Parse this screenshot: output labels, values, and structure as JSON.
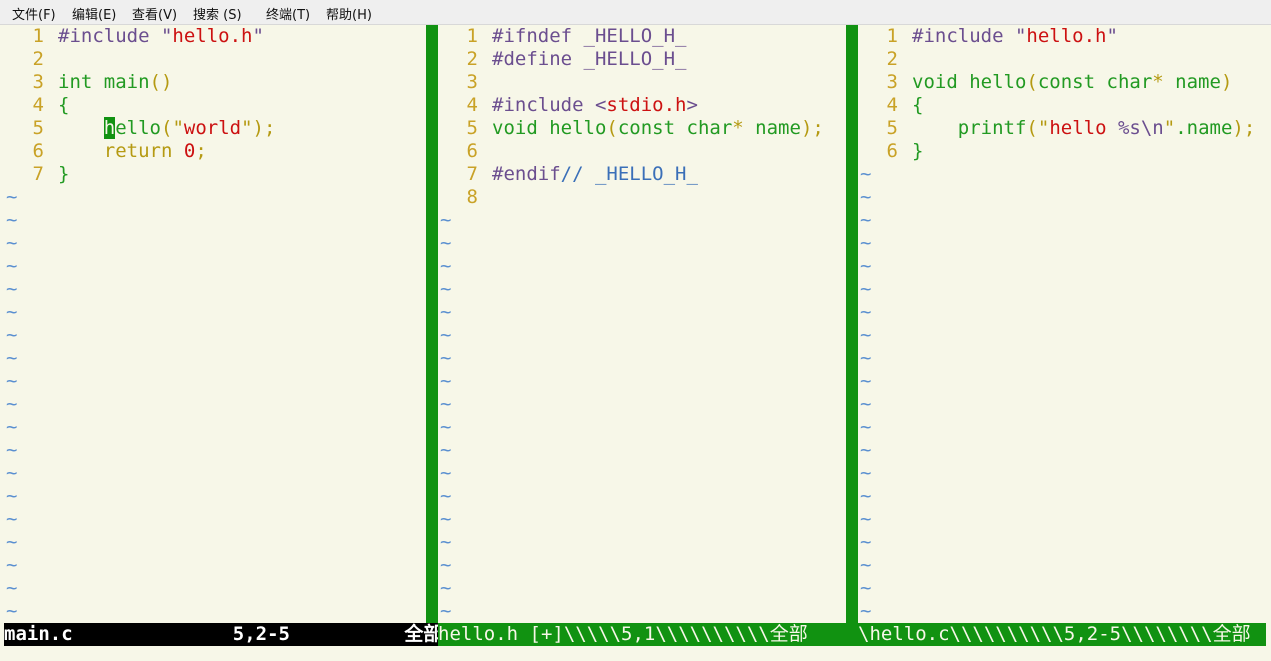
{
  "menu": [
    {
      "label": "文件(F)"
    },
    {
      "label": "编辑(E)"
    },
    {
      "label": "查看(V)"
    },
    {
      "label": "搜索 (S)"
    },
    {
      "label": "终端(T)"
    },
    {
      "label": "帮助(H)"
    }
  ],
  "panes": [
    {
      "name": "main.c",
      "tildes": 19,
      "lines": [
        {
          "n": "1",
          "tokens": [
            {
              "t": "#include ",
              "c": "pre"
            },
            {
              "t": "\"",
              "c": "pre"
            },
            {
              "t": "hello.h",
              "c": "str"
            },
            {
              "t": "\"",
              "c": "pre"
            }
          ]
        },
        {
          "n": "2",
          "tokens": []
        },
        {
          "n": "3",
          "tokens": [
            {
              "t": "int",
              "c": "type"
            },
            {
              "t": " main",
              "c": "fn"
            },
            {
              "t": "()",
              "c": "punc"
            }
          ]
        },
        {
          "n": "4",
          "tokens": [
            {
              "t": "{",
              "c": "plain"
            }
          ]
        },
        {
          "n": "5",
          "tokens": [
            {
              "t": "    ",
              "c": "plain"
            },
            {
              "t": "h",
              "c": "cursor"
            },
            {
              "t": "ello",
              "c": "fn"
            },
            {
              "t": "(",
              "c": "punc"
            },
            {
              "t": "\"",
              "c": "punc"
            },
            {
              "t": "world",
              "c": "str"
            },
            {
              "t": "\"",
              "c": "punc"
            },
            {
              "t": ");",
              "c": "punc"
            }
          ]
        },
        {
          "n": "6",
          "tokens": [
            {
              "t": "    ",
              "c": "plain"
            },
            {
              "t": "return",
              "c": "kw"
            },
            {
              "t": " ",
              "c": "plain"
            },
            {
              "t": "0",
              "c": "num"
            },
            {
              "t": ";",
              "c": "punc"
            }
          ]
        },
        {
          "n": "7",
          "tokens": [
            {
              "t": "}",
              "c": "plain"
            }
          ]
        }
      ]
    },
    {
      "name": "hello.h",
      "tildes": 18,
      "lines": [
        {
          "n": "1",
          "tokens": [
            {
              "t": "#ifndef _HELLO_H_",
              "c": "pre"
            }
          ]
        },
        {
          "n": "2",
          "tokens": [
            {
              "t": "#define _HELLO_H_",
              "c": "pre"
            }
          ]
        },
        {
          "n": "3",
          "tokens": []
        },
        {
          "n": "4",
          "tokens": [
            {
              "t": "#include ",
              "c": "pre"
            },
            {
              "t": "<",
              "c": "pre"
            },
            {
              "t": "stdio.h",
              "c": "str"
            },
            {
              "t": ">",
              "c": "pre"
            }
          ]
        },
        {
          "n": "5",
          "tokens": [
            {
              "t": "void",
              "c": "type"
            },
            {
              "t": " hello",
              "c": "fn"
            },
            {
              "t": "(",
              "c": "punc"
            },
            {
              "t": "const",
              "c": "type"
            },
            {
              "t": " ",
              "c": "plain"
            },
            {
              "t": "char",
              "c": "type"
            },
            {
              "t": "*",
              "c": "punc"
            },
            {
              "t": " name",
              "c": "plain"
            },
            {
              "t": ");",
              "c": "punc"
            }
          ]
        },
        {
          "n": "6",
          "tokens": []
        },
        {
          "n": "7",
          "tokens": [
            {
              "t": "#endif",
              "c": "pre"
            },
            {
              "t": "// _HELLO_H_",
              "c": "cmt"
            }
          ]
        },
        {
          "n": "8",
          "tokens": []
        }
      ]
    },
    {
      "name": "hello.c",
      "tildes": 20,
      "lines": [
        {
          "n": "1",
          "tokens": [
            {
              "t": "#include ",
              "c": "pre"
            },
            {
              "t": "\"",
              "c": "pre"
            },
            {
              "t": "hello.h",
              "c": "str"
            },
            {
              "t": "\"",
              "c": "pre"
            }
          ]
        },
        {
          "n": "2",
          "tokens": []
        },
        {
          "n": "3",
          "tokens": [
            {
              "t": "void",
              "c": "type"
            },
            {
              "t": " hello",
              "c": "fn"
            },
            {
              "t": "(",
              "c": "punc"
            },
            {
              "t": "const",
              "c": "type"
            },
            {
              "t": " ",
              "c": "plain"
            },
            {
              "t": "char",
              "c": "type"
            },
            {
              "t": "*",
              "c": "punc"
            },
            {
              "t": " name",
              "c": "plain"
            },
            {
              "t": ")",
              "c": "punc"
            }
          ]
        },
        {
          "n": "4",
          "tokens": [
            {
              "t": "{",
              "c": "plain"
            }
          ]
        },
        {
          "n": "5",
          "tokens": [
            {
              "t": "    ",
              "c": "plain"
            },
            {
              "t": "printf",
              "c": "fn"
            },
            {
              "t": "(",
              "c": "punc"
            },
            {
              "t": "\"",
              "c": "punc"
            },
            {
              "t": "hello ",
              "c": "str"
            },
            {
              "t": "%s",
              "c": "pre"
            },
            {
              "t": "\\n",
              "c": "pre"
            },
            {
              "t": "\"",
              "c": "punc"
            },
            {
              "t": ".name",
              "c": "plain"
            },
            {
              "t": ");",
              "c": "punc"
            }
          ]
        },
        {
          "n": "6",
          "tokens": [
            {
              "t": "}",
              "c": "plain"
            }
          ]
        }
      ]
    }
  ],
  "status": {
    "left": "main.c              5,2-5          全部",
    "mid": "hello.h [+]\\\\\\\\\\5,1\\\\\\\\\\\\\\\\\\\\全部",
    "right": "\\hello.c\\\\\\\\\\\\\\\\\\\\5,2-5\\\\\\\\\\\\\\\\全部"
  },
  "colors": {
    "background": "#f7f7e8",
    "split_green": "#119211",
    "string_red": "#cc1111",
    "preproc_purple": "#6b4e8f",
    "type_green": "#229a22",
    "keyword_gold": "#b59a12",
    "tilde_blue": "#5a8fd0"
  }
}
